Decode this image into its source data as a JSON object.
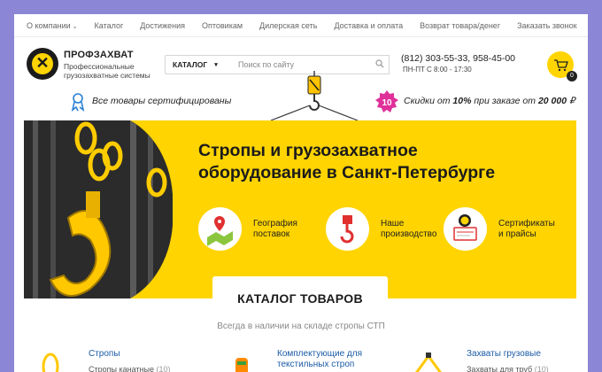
{
  "topnav": {
    "items": [
      "О компании",
      "Каталог",
      "Достижения",
      "Оптовикам",
      "Дилерская сеть",
      "Доставка и оплата",
      "Возврат товара/денег"
    ],
    "call_label": "Заказать звонок"
  },
  "brand": {
    "name": "ПРОФЗАХВАТ",
    "tagline": "Профессиональные грузозахватные системы"
  },
  "header": {
    "catalog_label": "КАТАЛОГ",
    "search_placeholder": "Поиск по сайту",
    "phones": "(812) 303-55-33, 958-45-00",
    "hours": "ПН-ПТ С 8:00 - 17:30",
    "cart_count": "0"
  },
  "info": {
    "certified": "Все товары сертифицированы",
    "discount_badge": "10",
    "discount_prefix": "Скидки от",
    "discount_pct": "10%",
    "discount_mid": "при заказе от",
    "discount_amount": "20 000",
    "currency": "₽"
  },
  "banner": {
    "title_line1": "Стропы и грузозахватное",
    "title_line2": "оборудование в Санкт-Петербурге",
    "features": [
      {
        "line1": "География",
        "line2": "поставок",
        "icon": "map-pin-icon"
      },
      {
        "line1": "Наше",
        "line2": "производство",
        "icon": "crane-hook-icon"
      },
      {
        "line1": "Сертификаты",
        "line2": "и прайсы",
        "icon": "certificate-icon"
      }
    ]
  },
  "catalog": {
    "title": "КАТАЛОГ ТОВАРОВ",
    "subtitle": "Всегда в наличии на складе стропы СТП",
    "cards": [
      {
        "title": "Стропы",
        "title2": "",
        "sub": "Стропы канатные",
        "count": "(10)"
      },
      {
        "title": "Комплектующие для",
        "title2": "текстильных строп",
        "sub": "",
        "count": ""
      },
      {
        "title": "Захваты грузовые",
        "title2": "",
        "sub": "Захваты для труб",
        "count": "(10)"
      }
    ]
  },
  "colors": {
    "accent": "#ffd400",
    "link": "#1a5aa6",
    "discount_badge": "#e0309a",
    "background": "#8b86d6"
  }
}
